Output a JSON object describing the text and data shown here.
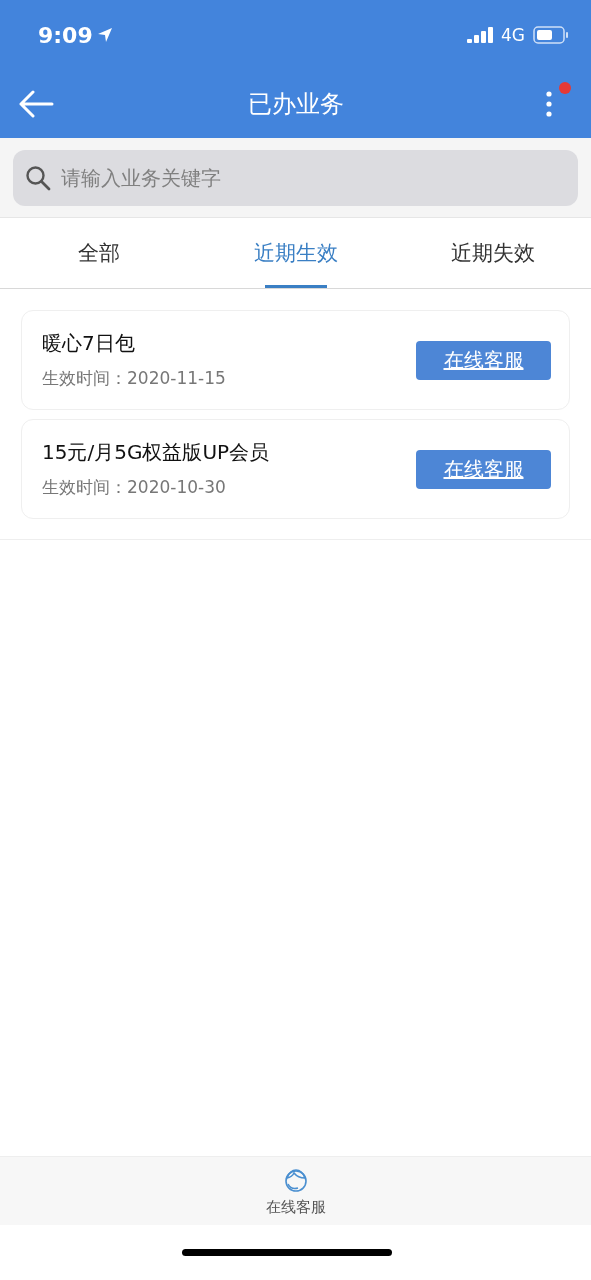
{
  "status_bar": {
    "time": "9:09",
    "network": "4G"
  },
  "header": {
    "title": "已办业务",
    "notification": true
  },
  "search": {
    "placeholder": "请输入业务关键字"
  },
  "tabs": [
    {
      "label": "全部",
      "selected": false
    },
    {
      "label": "近期生效",
      "selected": true
    },
    {
      "label": "近期失效",
      "selected": false
    }
  ],
  "items": [
    {
      "name": "暖心7日包",
      "date_label": "生效时间：",
      "date": "2020-11-15",
      "button": "在线客服"
    },
    {
      "name": "15元/月5G权益版UP会员",
      "date_label": "生效时间：",
      "date": "2020-10-30",
      "button": "在线客服"
    }
  ],
  "bottom_bar": {
    "label": "在线客服"
  }
}
